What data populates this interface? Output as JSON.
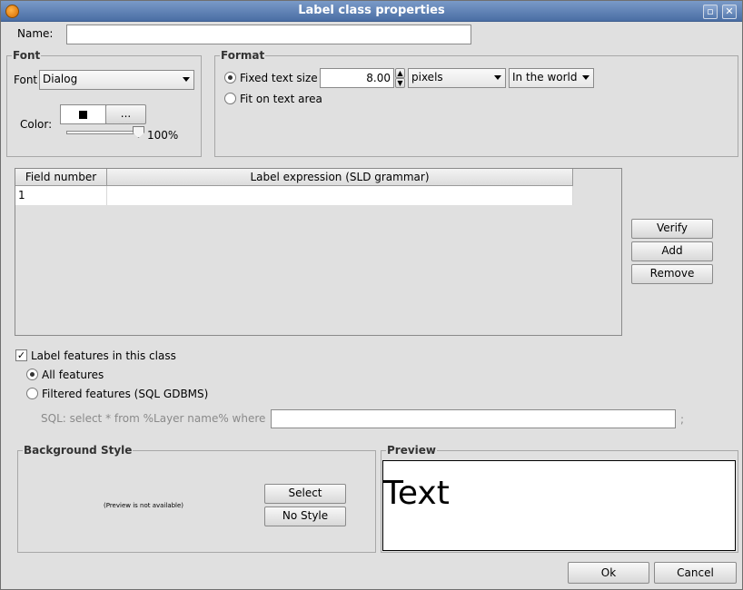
{
  "window": {
    "title": "Label class properties",
    "maximize_icon": "maximize-icon",
    "close_icon": "close-icon"
  },
  "name": {
    "label": "Name:",
    "value": ""
  },
  "font_group": {
    "title": "Font",
    "font_label": "Font",
    "font_value": "Dialog",
    "color_label": "Color:",
    "color_swatch": "#000000",
    "color_button": "...",
    "opacity": "100%"
  },
  "format_group": {
    "title": "Format",
    "fixed_label": "Fixed text size",
    "size_value": "8.00",
    "units_value": "pixels",
    "reference_value": "In the world",
    "fit_label": "Fit on text area"
  },
  "table": {
    "columns": [
      "Field number",
      "Label expression (SLD grammar)"
    ],
    "rows": [
      {
        "field": "1",
        "expression": ""
      }
    ]
  },
  "side_buttons": {
    "verify": "Verify",
    "add": "Add",
    "remove": "Remove"
  },
  "label_features": {
    "checkbox_label": "Label features in this class",
    "all_label": "All features",
    "filtered_label": "Filtered features (SQL GDBMS)",
    "sql_label": "SQL: select * from  %Layer name%  where",
    "sql_value": "",
    "sql_end": ";"
  },
  "background_style": {
    "title": "Background Style",
    "preview_note": "(Preview is not available)",
    "select_button": "Select",
    "nostyle_button": "No Style"
  },
  "preview": {
    "title": "Preview",
    "text": "Text"
  },
  "footer": {
    "ok": "Ok",
    "cancel": "Cancel"
  }
}
